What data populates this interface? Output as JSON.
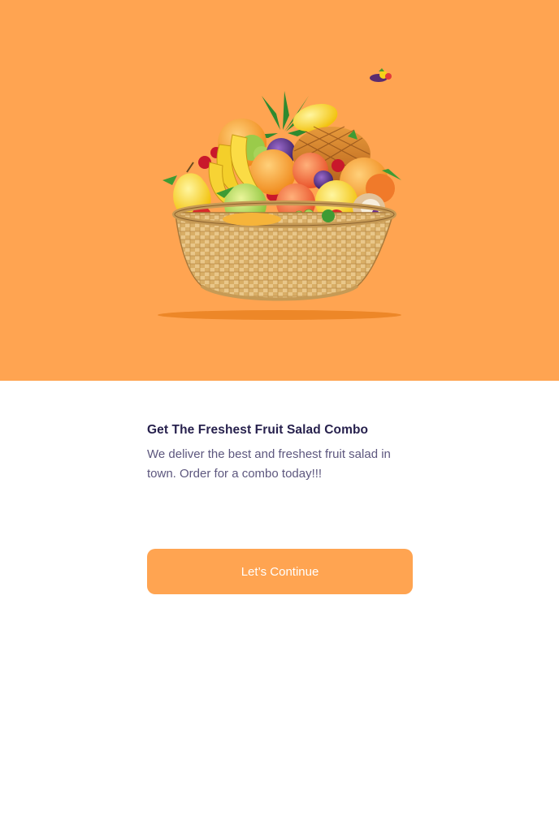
{
  "hero": {
    "background_color": "#FFA451",
    "image_name": "fruit-basket-illustration"
  },
  "welcome": {
    "title": "Get The Freshest Fruit Salad Combo",
    "description": "We deliver the best and freshest fruit salad in town. Order for a combo today!!!"
  },
  "actions": {
    "continue_label": "Let’s Continue"
  },
  "colors": {
    "accent": "#FFA451",
    "title": "#27214D",
    "body_text": "#5D577E"
  }
}
